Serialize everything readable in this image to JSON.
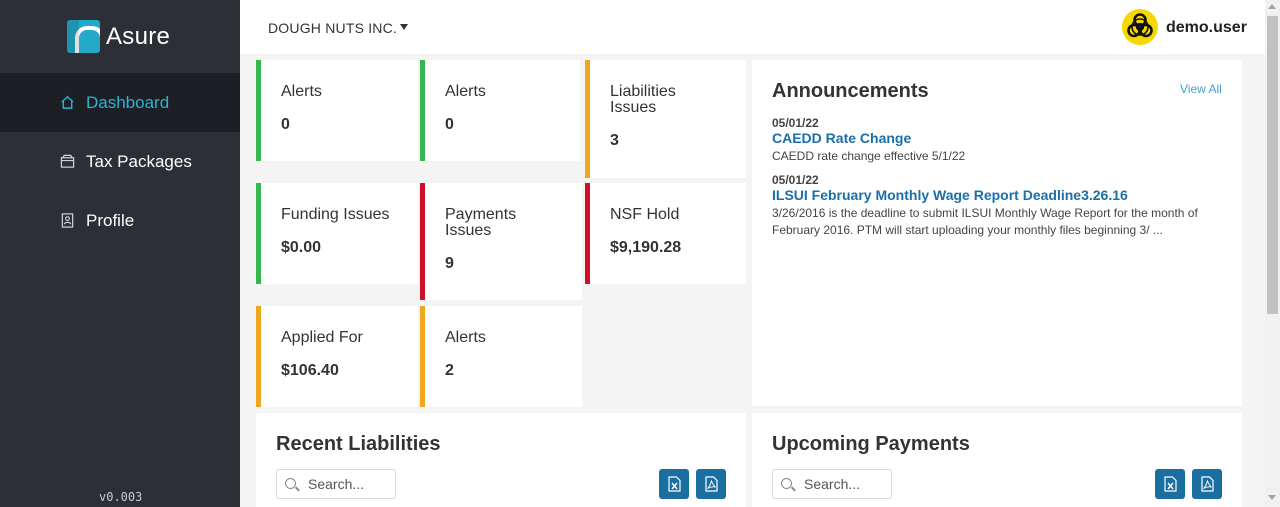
{
  "app": {
    "name": "Asure",
    "version": "v0.003"
  },
  "sidebar": {
    "items": [
      {
        "label": "Dashboard",
        "icon": "home-icon",
        "active": true
      },
      {
        "label": "Tax Packages",
        "icon": "package-icon",
        "active": false
      },
      {
        "label": "Profile",
        "icon": "profile-icon",
        "active": false
      }
    ]
  },
  "header": {
    "company": "DOUGH NUTS INC.",
    "username": "demo.user",
    "avatar_icon": "biohazard-icon"
  },
  "cards": [
    {
      "label": "Alerts",
      "value": "0",
      "status": "green"
    },
    {
      "label": "Alerts",
      "value": "0",
      "status": "green"
    },
    {
      "label": "Liabilities Issues",
      "value": "3",
      "status": "orange"
    },
    {
      "label": "Funding Issues",
      "value": "$0.00",
      "status": "green"
    },
    {
      "label": "Payments Issues",
      "value": "9",
      "status": "red"
    },
    {
      "label": "NSF Hold",
      "value": "$9,190.28",
      "status": "red"
    },
    {
      "label": "Applied For",
      "value": "$106.40",
      "status": "orange"
    },
    {
      "label": "Alerts",
      "value": "2",
      "status": "orange"
    }
  ],
  "announcements": {
    "title": "Announcements",
    "view_all": "View All",
    "items": [
      {
        "date": "05/01/22",
        "title": "CAEDD Rate Change",
        "body": "CAEDD rate change effective 5/1/22"
      },
      {
        "date": "05/01/22",
        "title": "ILSUI February Monthly Wage Report Deadline3.26.16",
        "body": "3/26/2016 is the deadline to submit ILSUI Monthly Wage Report for the month of February 2016. PTM will start uploading your monthly files beginning 3/ ..."
      }
    ]
  },
  "recent_liabilities": {
    "title": "Recent Liabilities",
    "search_placeholder": "Search..."
  },
  "upcoming_payments": {
    "title": "Upcoming Payments",
    "search_placeholder": "Search..."
  },
  "colors": {
    "sidebar": "#2c2f35",
    "accent": "#2ab3d4",
    "green": "#35b64f",
    "orange": "#f0a71d",
    "red": "#d0102b",
    "link": "#1b6fa8",
    "button": "#1a6fa0"
  }
}
